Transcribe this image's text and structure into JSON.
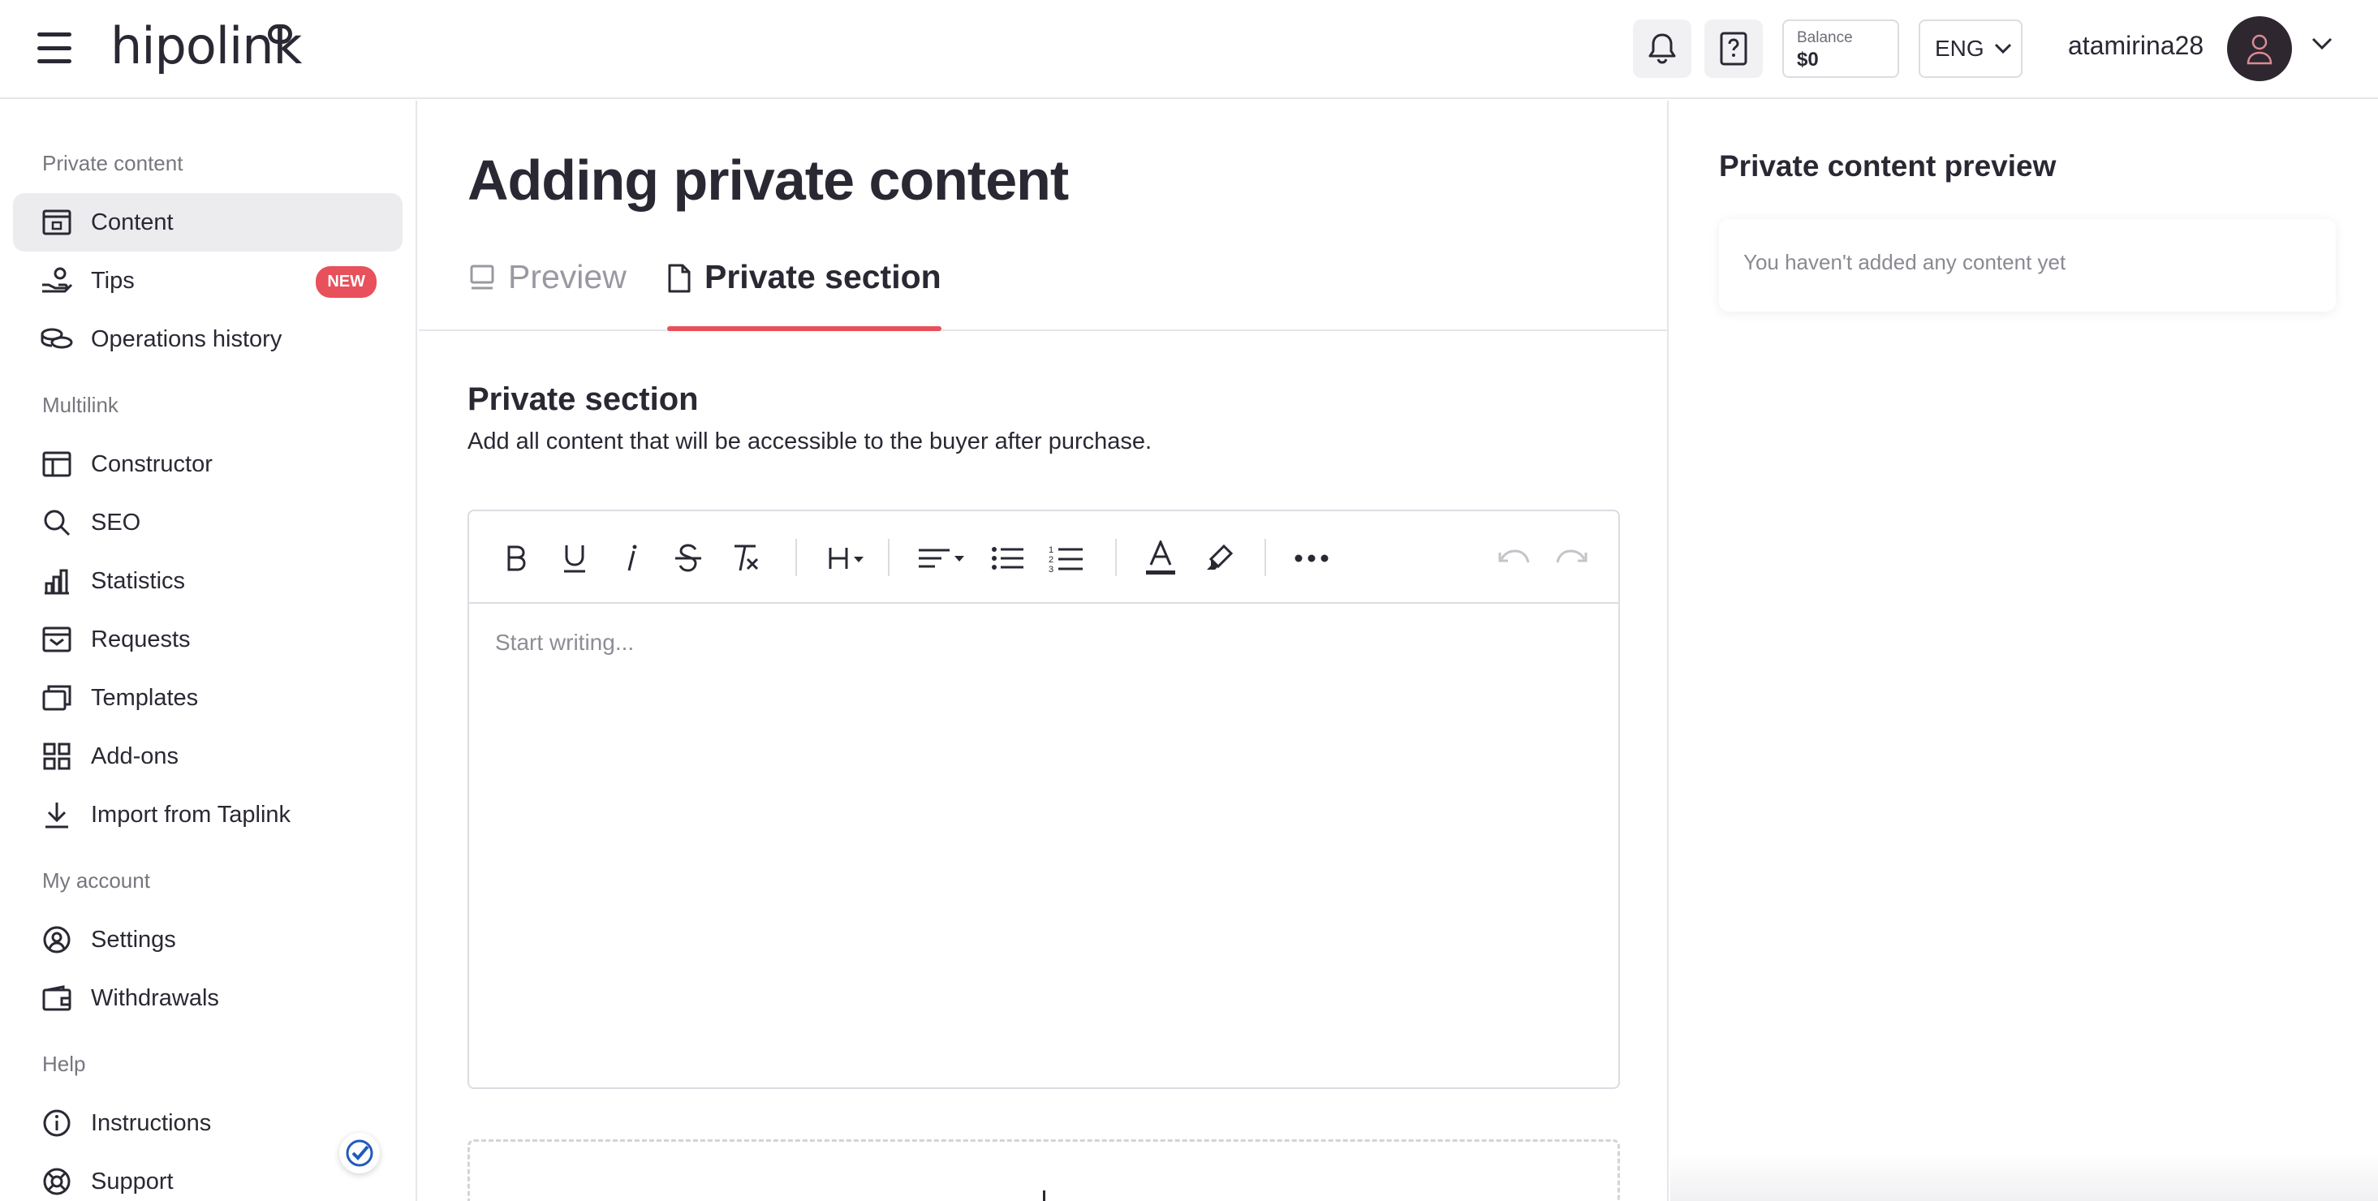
{
  "header": {
    "logo": "hipolink",
    "balance_label": "Balance",
    "balance_value": "$0",
    "language": "ENG",
    "username": "atamirina28"
  },
  "sidebar": {
    "sections": [
      {
        "title": "Private content",
        "items": [
          {
            "label": "Content",
            "icon": "lock-box-icon",
            "active": true
          },
          {
            "label": "Tips",
            "icon": "hand-coins-icon",
            "badge": "NEW"
          },
          {
            "label": "Operations history",
            "icon": "coins-icon"
          }
        ]
      },
      {
        "title": "Multilink",
        "items": [
          {
            "label": "Constructor",
            "icon": "layout-icon"
          },
          {
            "label": "SEO",
            "icon": "search-icon"
          },
          {
            "label": "Statistics",
            "icon": "bar-chart-icon"
          },
          {
            "label": "Requests",
            "icon": "inbox-icon"
          },
          {
            "label": "Templates",
            "icon": "copy-icon"
          },
          {
            "label": "Add-ons",
            "icon": "grid-icon"
          },
          {
            "label": "Import from Taplink",
            "icon": "download-icon"
          }
        ]
      },
      {
        "title": "My account",
        "items": [
          {
            "label": "Settings",
            "icon": "settings-icon"
          },
          {
            "label": "Withdrawals",
            "icon": "wallet-icon"
          }
        ]
      },
      {
        "title": "Help",
        "items": [
          {
            "label": "Instructions",
            "icon": "info-icon"
          },
          {
            "label": "Support",
            "icon": "lifebuoy-icon"
          }
        ]
      }
    ]
  },
  "main": {
    "title": "Adding private content",
    "tabs": [
      {
        "label": "Preview",
        "icon": "preview-icon",
        "active": false
      },
      {
        "label": "Private section",
        "icon": "document-icon",
        "active": true
      }
    ],
    "section_heading": "Private section",
    "section_description": "Add all content that will be accessible to the buyer after purchase.",
    "editor": {
      "placeholder": "Start writing...",
      "toolbar": [
        "bold",
        "underline",
        "italic",
        "strikethrough",
        "clear-format",
        "heading",
        "align",
        "bullet-list",
        "numbered-list",
        "text-color",
        "highlight",
        "more",
        "undo",
        "redo"
      ]
    }
  },
  "right_panel": {
    "title": "Private content preview",
    "empty_message": "You haven't added any content yet"
  },
  "colors": {
    "accent": "#e8505b",
    "text": "#2a2833",
    "avatar_bg": "#2e2730"
  }
}
